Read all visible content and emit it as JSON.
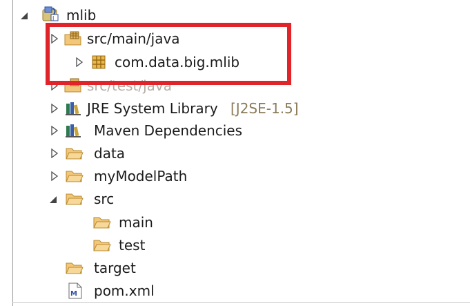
{
  "tree": {
    "project": {
      "label": "mlib"
    },
    "src_main_java": {
      "label": "src/main/java"
    },
    "package": {
      "label": "com.data.big.mlib"
    },
    "src_test_java": {
      "label": "src/test/java"
    },
    "jre": {
      "label": "JRE System Library",
      "decoration": "[J2SE-1.5]"
    },
    "maven": {
      "label": "Maven Dependencies"
    },
    "data": {
      "label": "data"
    },
    "model_path": {
      "label": "myModelPath"
    },
    "src": {
      "label": "src"
    },
    "main": {
      "label": "main"
    },
    "test": {
      "label": "test"
    },
    "target": {
      "label": "target"
    },
    "pom": {
      "label": "pom.xml"
    }
  },
  "colors": {
    "highlight": "#e0242a",
    "folder": "#f2c77a",
    "folder_edge": "#b98a2e",
    "text": "#1b1b1b",
    "decoration": "#8a7a58"
  },
  "icons": {
    "expanded": "twisty-expanded-icon",
    "collapsed": "twisty-collapsed-icon",
    "project": "java-project-icon",
    "source_folder": "source-folder-icon",
    "package": "package-icon",
    "library": "library-icon",
    "folder": "folder-icon",
    "pom": "maven-pom-icon"
  }
}
